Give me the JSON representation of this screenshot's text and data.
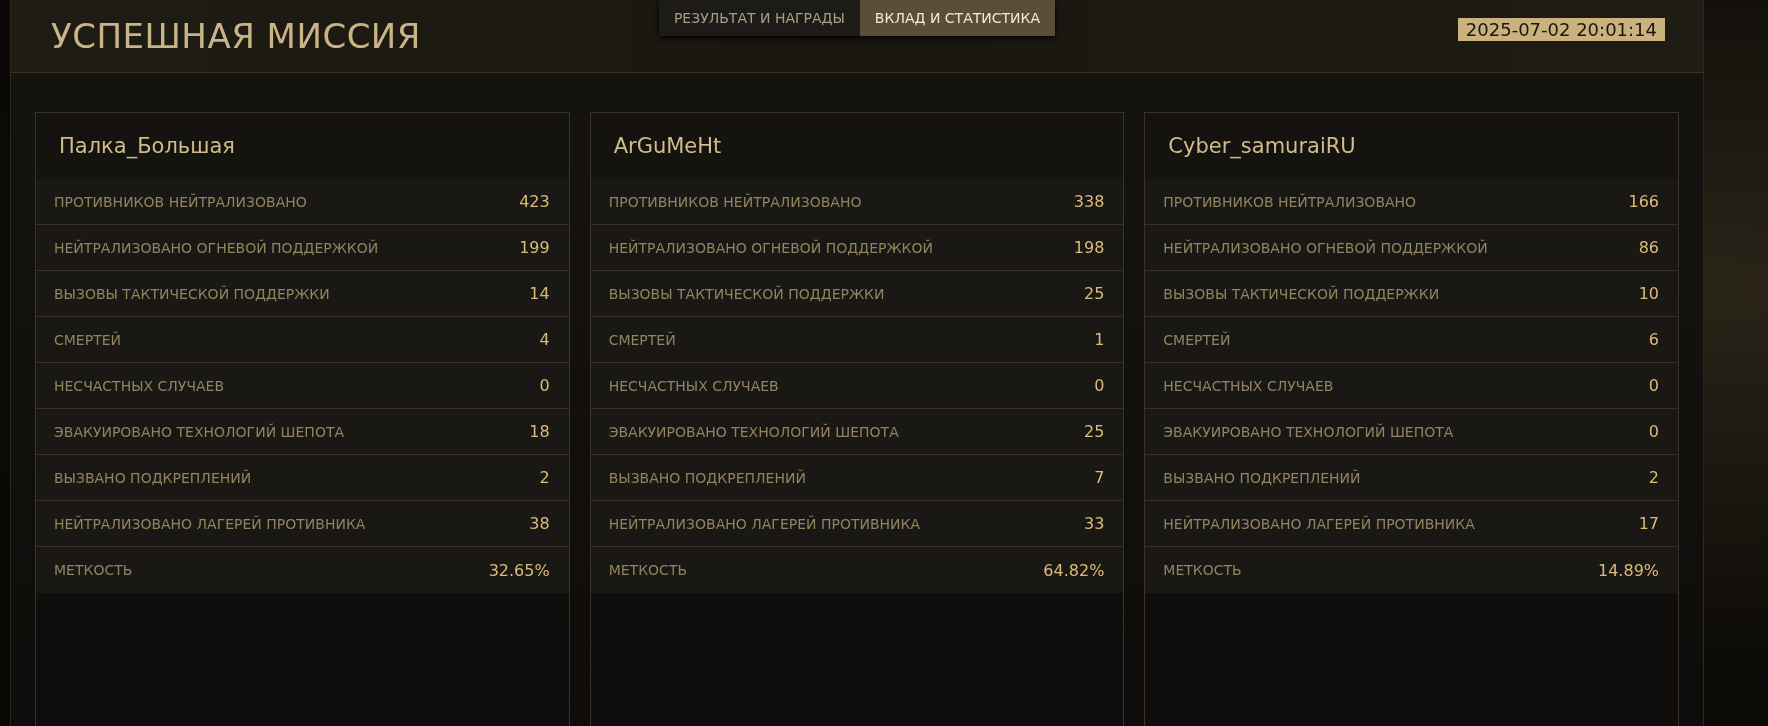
{
  "title": "УСПЕШНАЯ МИССИЯ",
  "tabs": [
    {
      "label": "РЕЗУЛЬТАТ И НАГРАДЫ",
      "selected": false
    },
    {
      "label": "ВКЛАД И СТАТИСТИКА",
      "selected": true
    }
  ],
  "timestamp": "2025-07-02 20:01:14",
  "players": [
    {
      "name": "Палка_Большая",
      "stats": [
        {
          "label": "ПРОТИВНИКОВ НЕЙТРАЛИЗОВАНО",
          "value": "423"
        },
        {
          "label": "НЕЙТРАЛИЗОВАНО ОГНЕВОЙ ПОДДЕРЖКОЙ",
          "value": "199"
        },
        {
          "label": "ВЫЗОВЫ ТАКТИЧЕСКОЙ ПОДДЕРЖКИ",
          "value": "14"
        },
        {
          "label": "СМЕРТЕЙ",
          "value": "4"
        },
        {
          "label": "НЕСЧАСТНЫХ СЛУЧАЕВ",
          "value": "0"
        },
        {
          "label": "ЭВАКУИРОВАНО ТЕХНОЛОГИЙ ШЕПОТА",
          "value": "18"
        },
        {
          "label": "ВЫЗВАНО ПОДКРЕПЛЕНИЙ",
          "value": "2"
        },
        {
          "label": "НЕЙТРАЛИЗОВАНО ЛАГЕРЕЙ ПРОТИВНИКА",
          "value": "38"
        },
        {
          "label": "МЕТКОСТЬ",
          "value": "32.65%"
        }
      ]
    },
    {
      "name": "ArGuMeHt",
      "stats": [
        {
          "label": "ПРОТИВНИКОВ НЕЙТРАЛИЗОВАНО",
          "value": "338"
        },
        {
          "label": "НЕЙТРАЛИЗОВАНО ОГНЕВОЙ ПОДДЕРЖКОЙ",
          "value": "198"
        },
        {
          "label": "ВЫЗОВЫ ТАКТИЧЕСКОЙ ПОДДЕРЖКИ",
          "value": "25"
        },
        {
          "label": "СМЕРТЕЙ",
          "value": "1"
        },
        {
          "label": "НЕСЧАСТНЫХ СЛУЧАЕВ",
          "value": "0"
        },
        {
          "label": "ЭВАКУИРОВАНО ТЕХНОЛОГИЙ ШЕПОТА",
          "value": "25"
        },
        {
          "label": "ВЫЗВАНО ПОДКРЕПЛЕНИЙ",
          "value": "7"
        },
        {
          "label": "НЕЙТРАЛИЗОВАНО ЛАГЕРЕЙ ПРОТИВНИКА",
          "value": "33"
        },
        {
          "label": "МЕТКОСТЬ",
          "value": "64.82%"
        }
      ]
    },
    {
      "name": "Cyber_samuraiRU",
      "stats": [
        {
          "label": "ПРОТИВНИКОВ НЕЙТРАЛИЗОВАНО",
          "value": "166"
        },
        {
          "label": "НЕЙТРАЛИЗОВАНО ОГНЕВОЙ ПОДДЕРЖКОЙ",
          "value": "86"
        },
        {
          "label": "ВЫЗОВЫ ТАКТИЧЕСКОЙ ПОДДЕРЖКИ",
          "value": "10"
        },
        {
          "label": "СМЕРТЕЙ",
          "value": "6"
        },
        {
          "label": "НЕСЧАСТНЫХ СЛУЧАЕВ",
          "value": "0"
        },
        {
          "label": "ЭВАКУИРОВАНО ТЕХНОЛОГИЙ ШЕПОТА",
          "value": "0"
        },
        {
          "label": "ВЫЗВАНО ПОДКРЕПЛЕНИЙ",
          "value": "2"
        },
        {
          "label": "НЕЙТРАЛИЗОВАНО ЛАГЕРЕЙ ПРОТИВНИКА",
          "value": "17"
        },
        {
          "label": "МЕТКОСТЬ",
          "value": "14.89%"
        }
      ]
    }
  ]
}
